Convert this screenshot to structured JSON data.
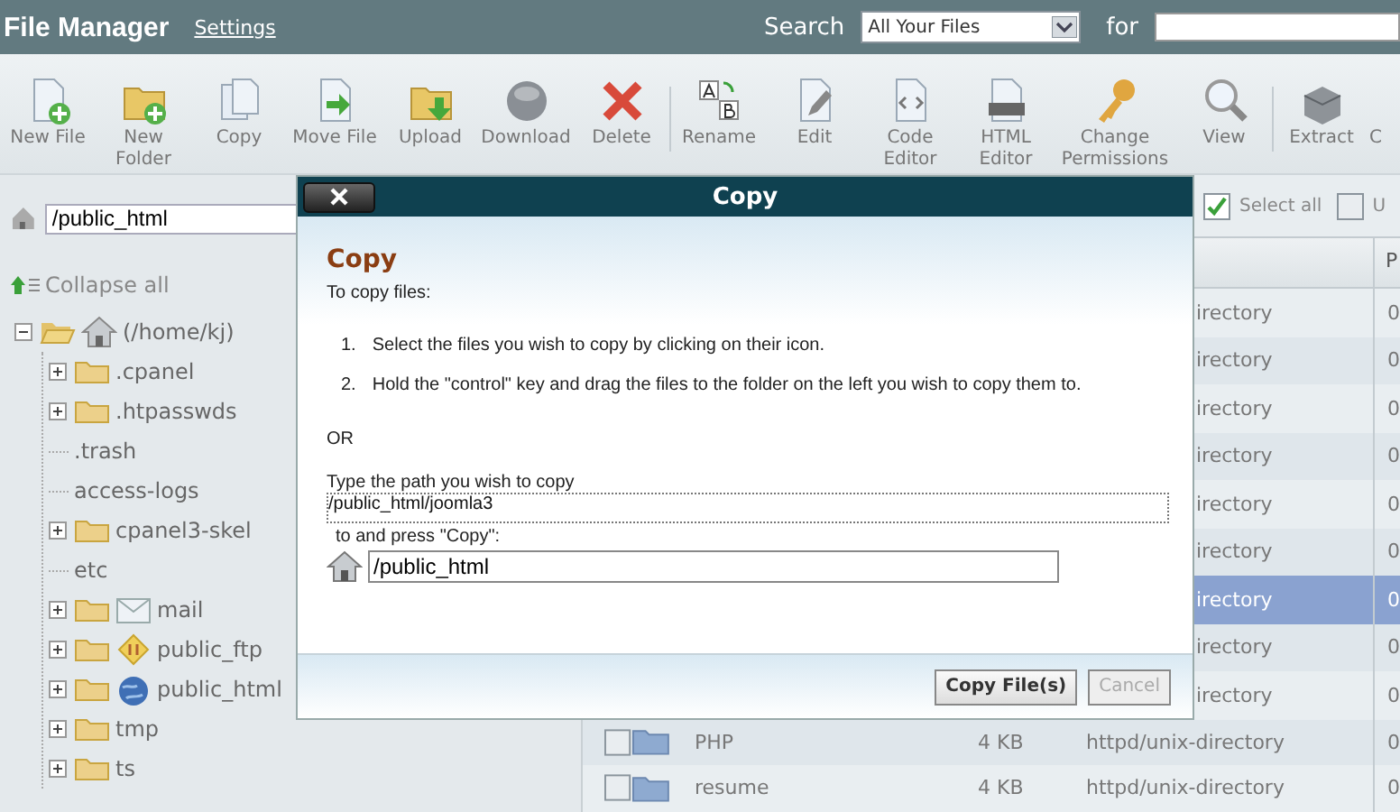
{
  "header": {
    "title": "File Manager",
    "settings_link": "Settings",
    "search_label": "Search",
    "search_scope": "All Your Files",
    "for_label": "for"
  },
  "toolbar": [
    {
      "kind": "new-file",
      "label": "New File"
    },
    {
      "kind": "new-folder",
      "label": "New Folder"
    },
    {
      "kind": "copy",
      "label": "Copy"
    },
    {
      "kind": "move",
      "label": "Move File"
    },
    {
      "kind": "upload",
      "label": "Upload"
    },
    {
      "kind": "download",
      "label": "Download"
    },
    {
      "kind": "delete",
      "label": "Delete"
    },
    {
      "kind": "separator"
    },
    {
      "kind": "rename",
      "label": "Rename"
    },
    {
      "kind": "edit",
      "label": "Edit"
    },
    {
      "kind": "code",
      "label": "Code Editor"
    },
    {
      "kind": "html",
      "label": "HTML Editor"
    },
    {
      "kind": "permissions",
      "label": "Change Permissions"
    },
    {
      "kind": "view",
      "label": "View"
    },
    {
      "kind": "separator"
    },
    {
      "kind": "extract",
      "label": "Extract"
    },
    {
      "kind": "partial",
      "label": "C"
    }
  ],
  "path_field": {
    "value": "/public_html"
  },
  "collapse_all": "Collapse all",
  "tree": [
    {
      "kind": "home",
      "label": "(/home/kj)",
      "expanded": true,
      "children": [
        {
          "kind": "folder",
          "label": ".cpanel",
          "expanded": false
        },
        {
          "kind": "folder",
          "label": ".htpasswds",
          "expanded": false
        },
        {
          "kind": "plain",
          "label": ".trash"
        },
        {
          "kind": "plain",
          "label": "access-logs"
        },
        {
          "kind": "folder",
          "label": "cpanel3-skel",
          "expanded": false
        },
        {
          "kind": "plain",
          "label": "etc"
        },
        {
          "kind": "mail",
          "label": "mail",
          "expanded": false
        },
        {
          "kind": "ftp",
          "label": "public_ftp",
          "expanded": false
        },
        {
          "kind": "web",
          "label": "public_html",
          "expanded": false
        },
        {
          "kind": "folder",
          "label": "tmp",
          "expanded": false
        },
        {
          "kind": "folder",
          "label": "ts",
          "expanded": false
        }
      ]
    }
  ],
  "select_all": {
    "label": "Select all",
    "checked": true
  },
  "unselect_all": {
    "label": "U",
    "checked": false
  },
  "table": {
    "column_5": "P",
    "rows": [
      {
        "kind": "partial",
        "type": "irectory",
        "perms": "0",
        "selected": false
      },
      {
        "kind": "partial",
        "type": "irectory",
        "perms": "0",
        "selected": false
      },
      {
        "kind": "partial",
        "type": "irectory",
        "perms": "0",
        "selected": false
      },
      {
        "kind": "partial",
        "type": "irectory",
        "perms": "0",
        "selected": false
      },
      {
        "kind": "partial",
        "type": "irectory",
        "perms": "0",
        "selected": false
      },
      {
        "kind": "partial",
        "type": "irectory",
        "perms": "0",
        "selected": false
      },
      {
        "kind": "partial",
        "type": "irectory",
        "perms": "0",
        "selected": true
      },
      {
        "kind": "partial",
        "type": "irectory",
        "perms": "0",
        "selected": false
      },
      {
        "kind": "partial",
        "type": "irectory",
        "perms": "0",
        "selected": false
      },
      {
        "kind": "full",
        "name": "PHP",
        "size": "4 KB",
        "type": "httpd/unix-directory",
        "perms": "0",
        "selected": false
      },
      {
        "kind": "full",
        "name": "resume",
        "size": "4 KB",
        "type": "httpd/unix-directory",
        "perms": "0",
        "selected": false
      }
    ]
  },
  "dialog": {
    "title": "Copy",
    "heading": "Copy",
    "intro": "To copy files:",
    "steps": [
      {
        "number": "1.",
        "text": "Select the files you wish to copy by clicking on their icon."
      },
      {
        "number": "2.",
        "text": "Hold the \"control\" key and drag the files to the folder on the left you wish to copy them to."
      }
    ],
    "or": "OR",
    "path_prompt": "Type the path you wish to copy",
    "source_path": "/public_html/joomla3",
    "dest_prompt": "to and press \"Copy\":",
    "dest_path": "/public_html",
    "buttons": [
      {
        "kind": "primary",
        "label": "Copy File(s)"
      },
      {
        "kind": "secondary",
        "label": "Cancel"
      }
    ]
  }
}
